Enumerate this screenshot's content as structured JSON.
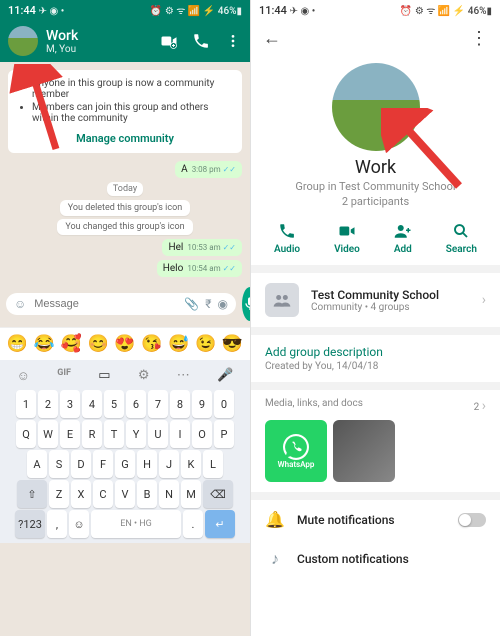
{
  "left": {
    "status": {
      "time": "11:44",
      "left_icons": "✈ ◉ •",
      "right_icons": "⏰ ⚙ ᯤ 📶 ⚡ 46%▮"
    },
    "header": {
      "title": "Work",
      "subtitle": "M, You"
    },
    "banner": {
      "line1": "Anyone in this group is now a community member",
      "line2": "Members can join this group and others within the community",
      "manage": "Manage community"
    },
    "msg_a": {
      "text": "A",
      "time": "3:08 pm"
    },
    "today": "Today",
    "sys1": "You deleted this group's icon",
    "sys2": "You changed this group's icon",
    "msg_hel": {
      "text": "Hel",
      "time": "10:53 am"
    },
    "msg_helo": {
      "text": "Helo",
      "time": "10:54 am"
    },
    "input": {
      "placeholder": "Message"
    },
    "kbd": {
      "lang": "EN • HG",
      "numpad": "?123"
    }
  },
  "right": {
    "status": {
      "time": "11:44",
      "left_icons": "✈ ◉ •",
      "right_icons": "⏰ ⚙ ᯤ 📶 ⚡ 46%▮"
    },
    "title": "Work",
    "subtitle1": "Group in Test Community School",
    "subtitle2": "2 participants",
    "actions": {
      "audio": "Audio",
      "video": "Video",
      "add": "Add",
      "search": "Search"
    },
    "community": {
      "name": "Test Community School",
      "sub": "Community • 4 groups"
    },
    "add_desc": "Add group description",
    "created": "Created by You, 14/04/18",
    "media_label": "Media, links, and docs",
    "media_count": "2 ",
    "thumb_wa": "WhatsApp",
    "mute": "Mute notifications",
    "custom": "Custom notifications"
  }
}
